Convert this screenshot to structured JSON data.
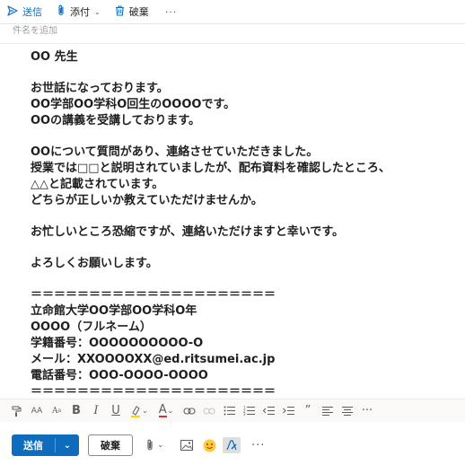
{
  "toolbar": {
    "send_label": "送信",
    "attach_label": "添付",
    "discard_label": "破棄",
    "more_label": "···"
  },
  "subject": {
    "placeholder": "件名を追加",
    "value": ""
  },
  "body": {
    "lines": [
      "OO 先生",
      "",
      "お世話になっております。",
      "OO学部OO学科O回生のOOOOです。",
      "OOの講義を受講しております。",
      "",
      "OOについて質問があり、連絡させていただきました。",
      "授業では□□と説明されていましたが、配布資料を確認したところ、",
      "△△と記載されています。",
      "どちらが正しいか教えていただけませんか。",
      "",
      "お忙しいところ恐縮ですが、連絡いただけますと幸いです。",
      "",
      "よろしくお願いします。",
      "",
      "＝＝＝＝＝＝＝＝＝＝＝＝＝＝＝＝＝＝＝＝＝",
      "立命館大学OO学部OO学科O年",
      "OOOO（フルネーム）",
      "学籍番号：OOOOOOOOOO-O",
      "メール：XXOOOOXX@ed.ritsumei.ac.jp",
      "電話番号：OOO-OOOO-OOOO",
      "＝＝＝＝＝＝＝＝＝＝＝＝＝＝＝＝＝＝＝＝＝"
    ]
  },
  "format_toolbar": {
    "font_size_label": "AA",
    "superscript_label": "A",
    "bold_label": "B",
    "italic_label": "I",
    "underline_label": "U",
    "font_color_label": "A",
    "quote_label": "”",
    "more_label": "···"
  },
  "actions": {
    "send_label": "送信",
    "discard_label": "破棄",
    "more_label": "···"
  },
  "colors": {
    "accent": "#0f6cbd",
    "highlight": "#ffd400",
    "font_color": "#d13438"
  }
}
